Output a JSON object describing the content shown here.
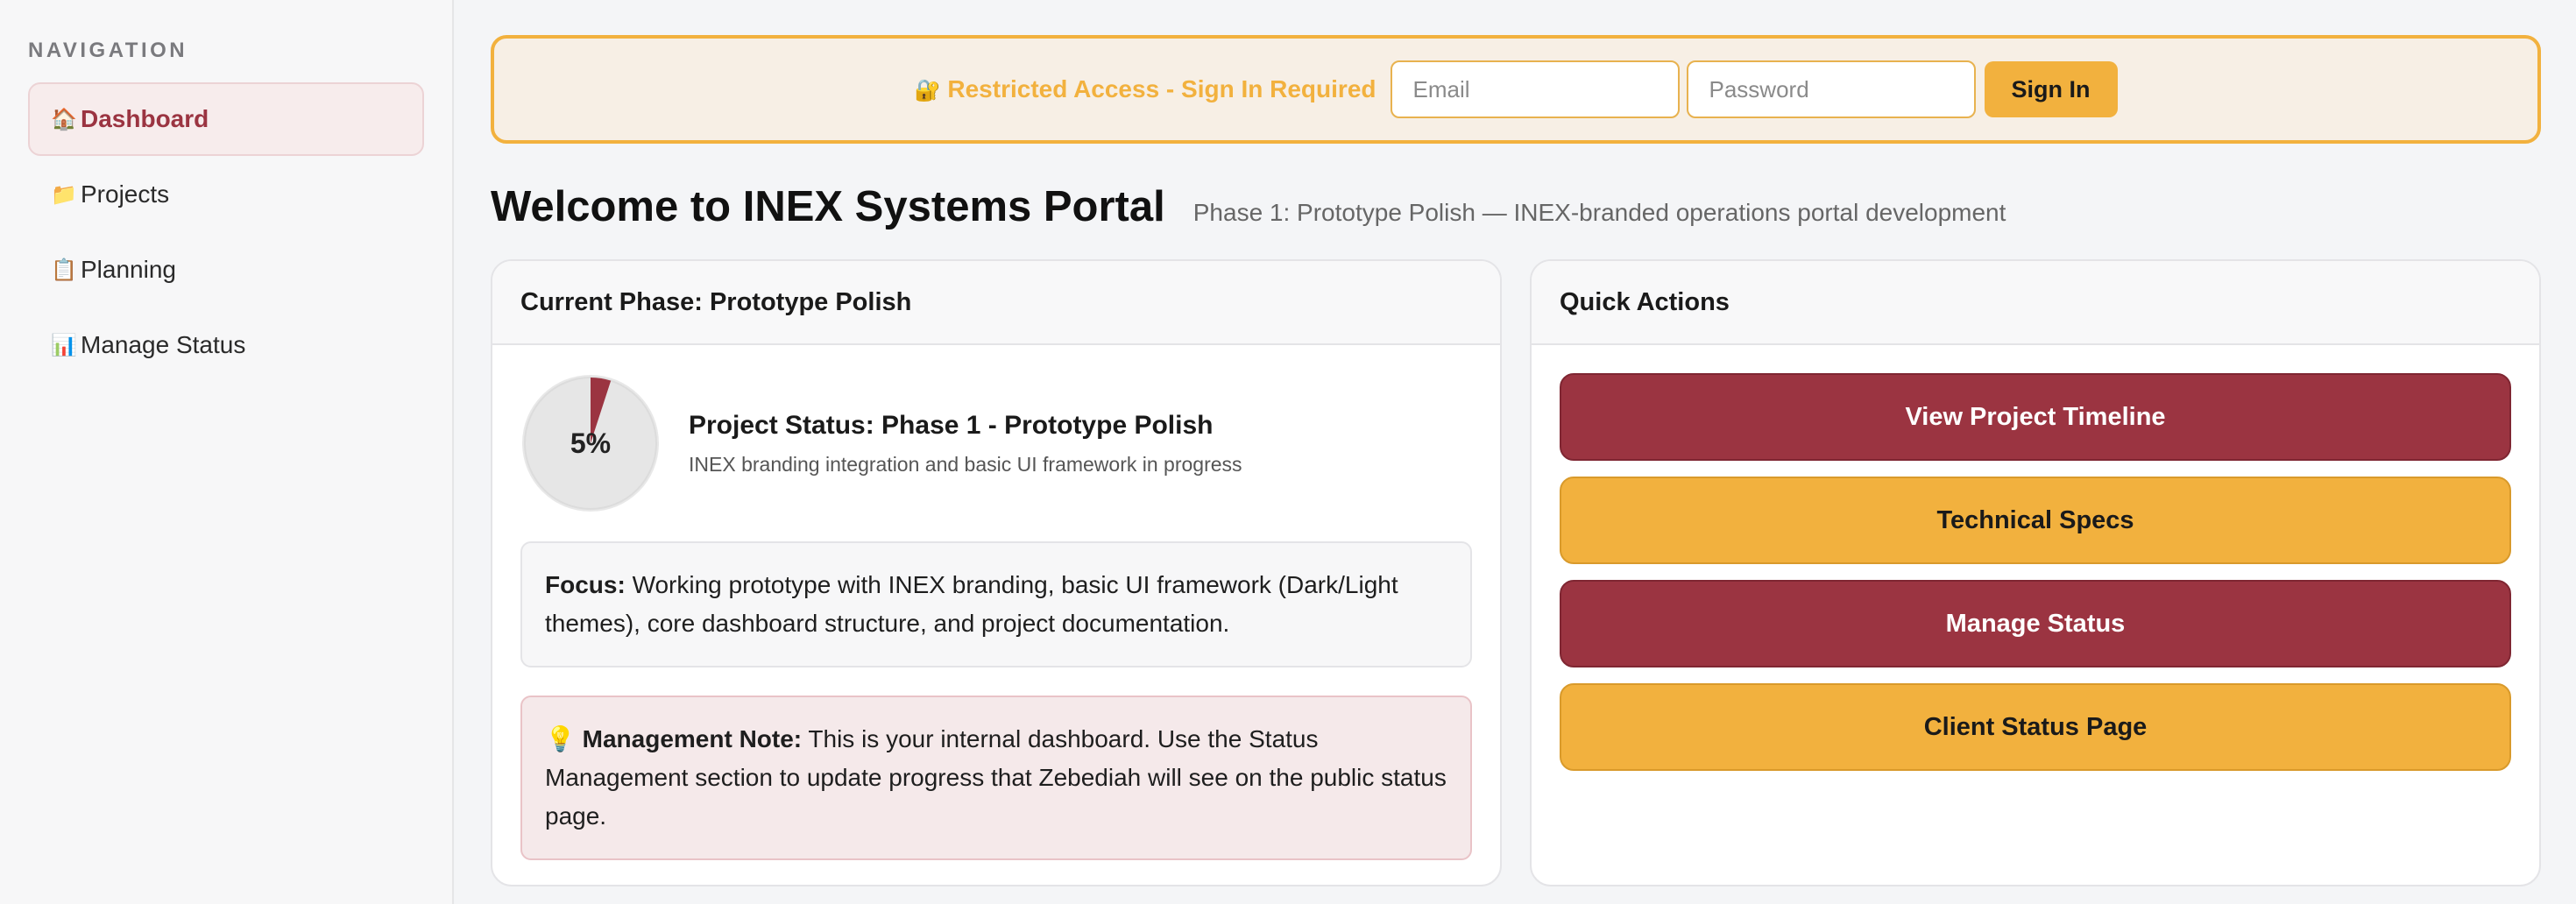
{
  "sidebar": {
    "heading": "NAVIGATION",
    "items": [
      {
        "icon": "🏠",
        "label": "Dashboard",
        "active": true
      },
      {
        "icon": "📁",
        "label": "Projects"
      },
      {
        "icon": "📋",
        "label": "Planning"
      },
      {
        "icon": "📊",
        "label": "Manage Status"
      }
    ]
  },
  "auth": {
    "icon": "🔐",
    "title": "Restricted Access - Sign In Required",
    "email_placeholder": "Email",
    "password_placeholder": "Password",
    "signin_label": "Sign In"
  },
  "header": {
    "title": "Welcome to INEX Systems Portal",
    "subtitle": "Phase 1: Prototype Polish — INEX-branded operations portal development"
  },
  "phase_card": {
    "title": "Current Phase: Prototype Polish",
    "progress_label": "5%",
    "progress": 0.05,
    "status_title": "Project Status: Phase 1 - Prototype Polish",
    "status_desc": "INEX branding integration and basic UI framework in progress",
    "focus_label": "Focus:",
    "focus_text": "Working prototype with INEX branding, basic UI framework (Dark/Light themes), core dashboard structure, and project documentation.",
    "note_icon": "💡",
    "note_label": "Management Note:",
    "note_text": "This is your internal dashboard. Use the Status Management section to update progress that Zebediah will see on the public status page."
  },
  "quick_actions": {
    "title": "Quick Actions",
    "buttons": [
      {
        "label": "View Project Timeline",
        "style": "primary"
      },
      {
        "label": "Technical Specs",
        "style": "accent"
      },
      {
        "label": "Manage Status",
        "style": "primary"
      },
      {
        "label": "Client Status Page",
        "style": "accent"
      }
    ]
  },
  "colors": {
    "brand": "#9b3441",
    "accent": "#f2b13e"
  }
}
